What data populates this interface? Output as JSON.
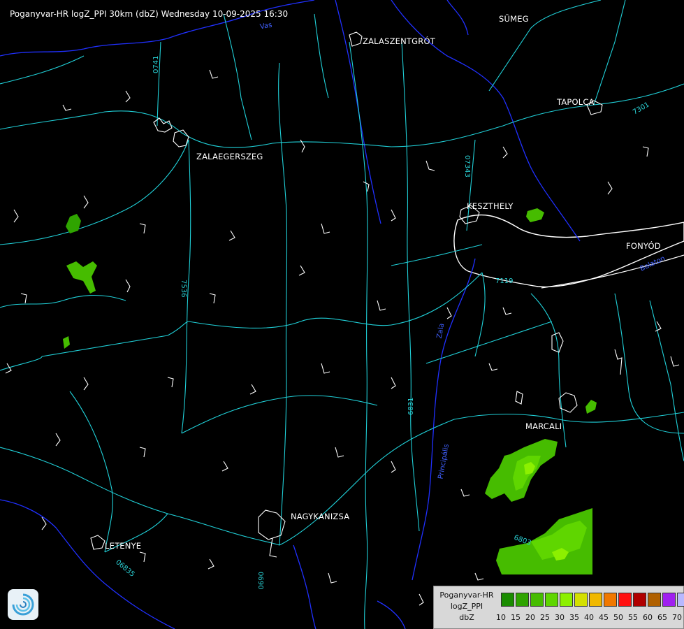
{
  "title": "Poganyvar-HR logZ_PPI 30km (dbZ) Wednesday 10-09-2025 16:30",
  "cities": [
    {
      "name": "SÜMEG"
    },
    {
      "name": "ZALASZENTGRÓT"
    },
    {
      "name": "TAPOLCA"
    },
    {
      "name": "ZALAEGERSZEG"
    },
    {
      "name": "KESZTHELY"
    },
    {
      "name": "FONYÓD"
    },
    {
      "name": "MARCALI"
    },
    {
      "name": "NAGYKANIZSA"
    },
    {
      "name": "LETENYE"
    }
  ],
  "road_labels": [
    "0741",
    "07343",
    "7301",
    "7536",
    "6831",
    "6803",
    "0690",
    "06835",
    "7119"
  ],
  "water_labels": [
    "Vas",
    "Zala",
    "Principális",
    "Balaton"
  ],
  "legend": {
    "name_lines": [
      "Poganyvar-HR",
      "logZ_PPI",
      "dbZ"
    ],
    "ticks": [
      "10",
      "15",
      "20",
      "25",
      "30",
      "35",
      "40",
      "45",
      "50",
      "55",
      "60",
      "65",
      "70"
    ],
    "colors": [
      "#1a8c00",
      "#2fa400",
      "#46bc00",
      "#5fd600",
      "#8cf000",
      "#d4e000",
      "#f0b800",
      "#f07800",
      "#ff1010",
      "#b00000",
      "#b06000",
      "#a020f0",
      "#b8b8ff"
    ]
  },
  "colors": {
    "roads": "#20d0d8",
    "rivers": "#2030ff",
    "settlements": "#ffffff",
    "lake_outline": "#ffffff"
  }
}
